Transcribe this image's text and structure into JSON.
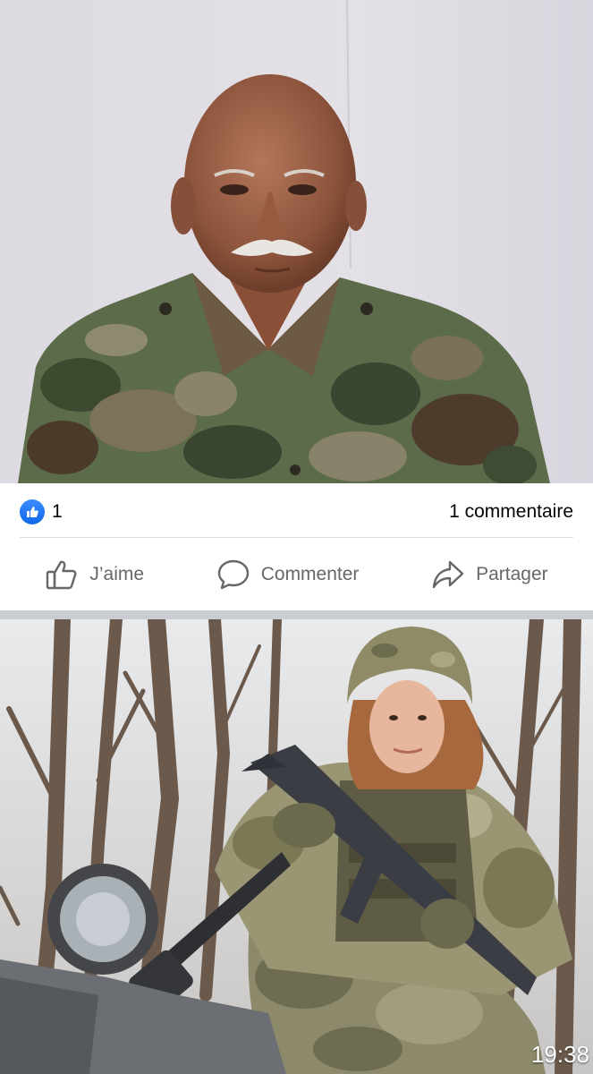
{
  "post_top": {
    "photo_alt": "Portrait of an older man with a white moustache in camouflage uniform"
  },
  "reactions": {
    "like_count": "1",
    "comments_count": "1 commentaire"
  },
  "actions": {
    "like_label": "J’aime",
    "comment_label": "Commenter",
    "share_label": "Partager"
  },
  "post_bottom": {
    "photo_alt": "Young woman soldier in helmet and camouflage holding a rifle in front of bare trees"
  },
  "status": {
    "time": "19:38"
  },
  "colors": {
    "like_blue": "#1877f2",
    "action_gray": "#65676b",
    "divider": "#dadde1"
  },
  "icons": [
    "like-reaction-icon",
    "thumbs-up-icon",
    "comment-bubble-icon",
    "share-arrow-icon"
  ]
}
